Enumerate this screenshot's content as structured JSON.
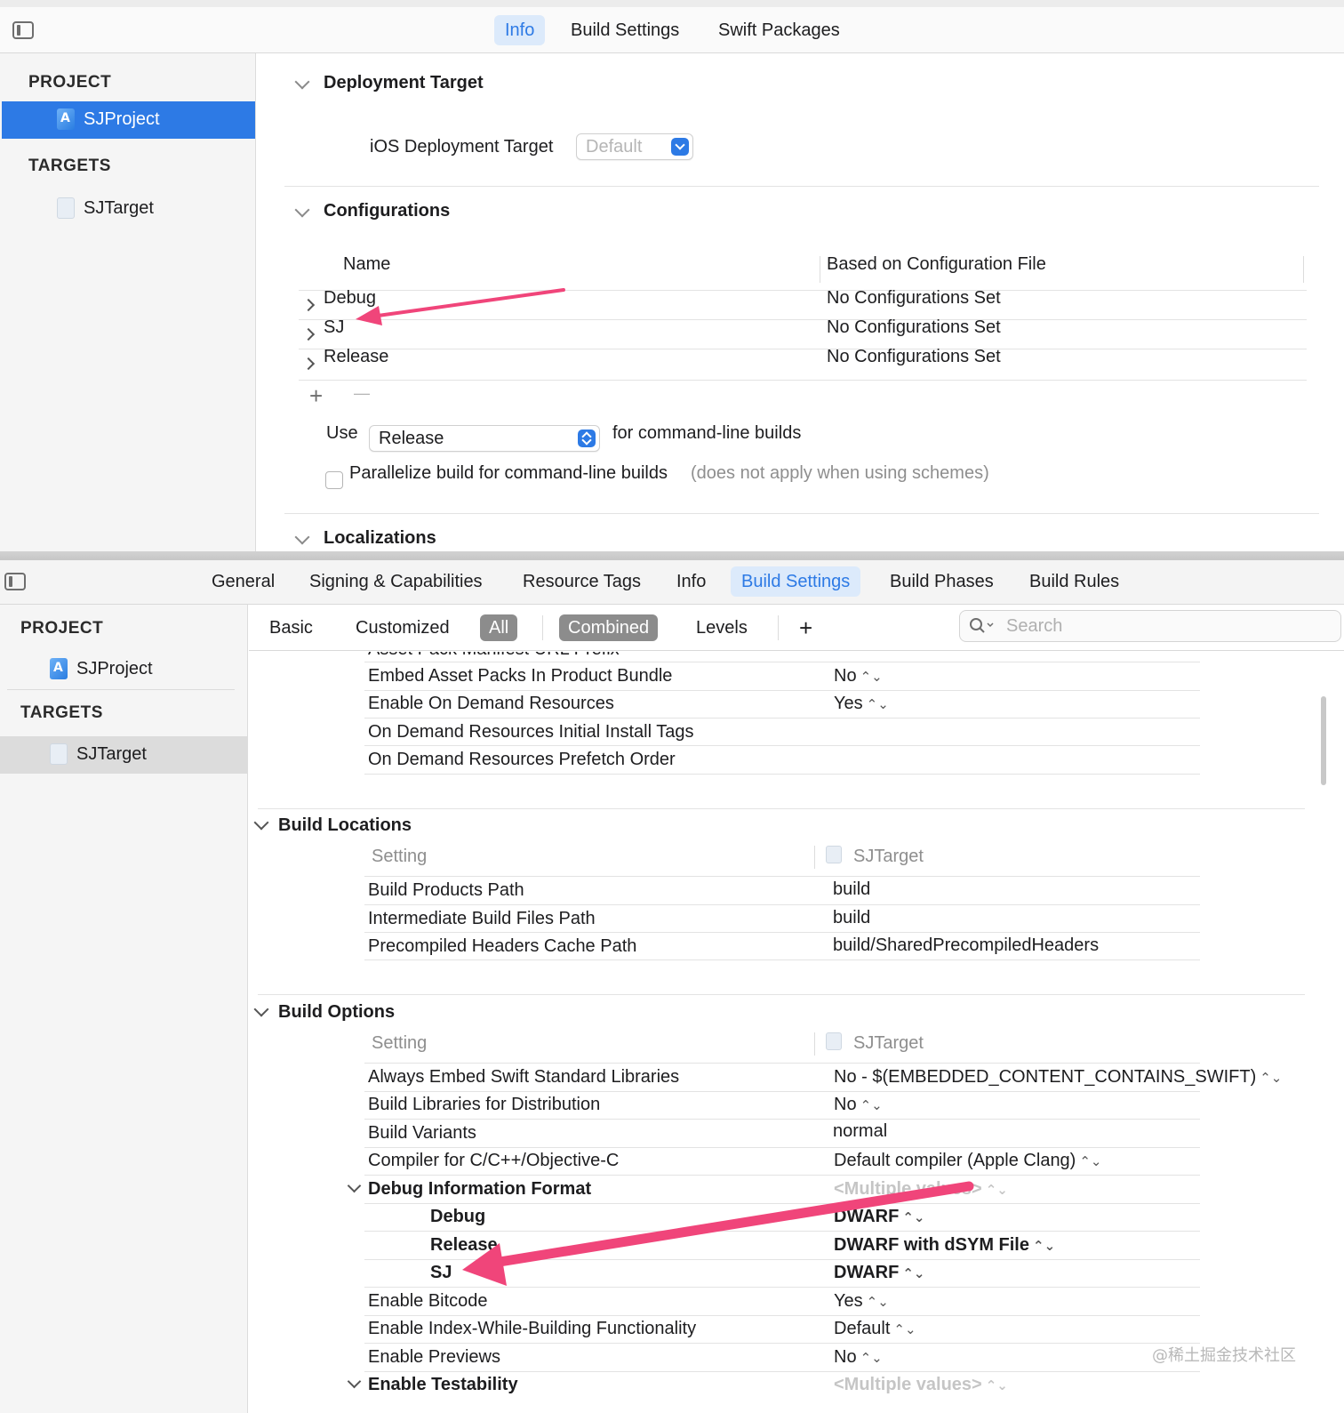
{
  "top": {
    "tabs": [
      "Info",
      "Build Settings",
      "Swift Packages"
    ],
    "active_tab": "Info",
    "sidebar": {
      "project_heading": "PROJECT",
      "project_item": "SJProject",
      "targets_heading": "TARGETS",
      "target_item": "SJTarget"
    },
    "deployment": {
      "title": "Deployment Target",
      "label": "iOS Deployment Target",
      "value": "Default"
    },
    "configurations": {
      "title": "Configurations",
      "col_name": "Name",
      "col_based": "Based on Configuration File",
      "rows": [
        {
          "name": "Debug",
          "based": "No Configurations Set"
        },
        {
          "name": "SJ",
          "based": "No Configurations Set"
        },
        {
          "name": "Release",
          "based": "No Configurations Set"
        }
      ],
      "add_symbol": "+",
      "remove_symbol": "—",
      "use_label": "Use",
      "use_value": "Release",
      "use_suffix": "for command-line builds",
      "parallelize_label": "Parallelize build for command-line builds",
      "parallelize_note": "(does not apply when using schemes)"
    },
    "localizations": {
      "title": "Localizations"
    }
  },
  "bottom": {
    "tabs": [
      "General",
      "Signing & Capabilities",
      "Resource Tags",
      "Info",
      "Build Settings",
      "Build Phases",
      "Build Rules"
    ],
    "active_tab": "Build Settings",
    "sidebar": {
      "project_heading": "PROJECT",
      "project_item": "SJProject",
      "targets_heading": "TARGETS",
      "target_item": "SJTarget"
    },
    "filters": [
      "Basic",
      "Customized",
      "All",
      "Combined",
      "Levels"
    ],
    "add_symbol": "+",
    "search_placeholder": "Search",
    "truncated_row": "Asset Pack Manifest URL Prefix",
    "asset_rows": [
      {
        "name": "Embed Asset Packs In Product Bundle",
        "value": "No",
        "stepper": true
      },
      {
        "name": "Enable On Demand Resources",
        "value": "Yes",
        "stepper": true
      },
      {
        "name": "On Demand Resources Initial Install Tags",
        "value": "",
        "stepper": false
      },
      {
        "name": "On Demand Resources Prefetch Order",
        "value": "",
        "stepper": false
      }
    ],
    "build_locations": {
      "title": "Build Locations",
      "col_setting": "Setting",
      "col_target": "SJTarget",
      "rows": [
        {
          "name": "Build Products Path",
          "value": "build"
        },
        {
          "name": "Intermediate Build Files Path",
          "value": "build"
        },
        {
          "name": "Precompiled Headers Cache Path",
          "value": "build/SharedPrecompiledHeaders"
        }
      ]
    },
    "build_options": {
      "title": "Build Options",
      "col_setting": "Setting",
      "col_target": "SJTarget",
      "rows": [
        {
          "name": "Always Embed Swift Standard Libraries",
          "value": "No  -  $(EMBEDDED_CONTENT_CONTAINS_SWIFT)",
          "stepper": true
        },
        {
          "name": "Build Libraries for Distribution",
          "value": "No",
          "stepper": true
        },
        {
          "name": "Build Variants",
          "value": "normal",
          "stepper": false
        },
        {
          "name": "Compiler for C/C++/Objective-C",
          "value": "Default compiler (Apple Clang)",
          "stepper": true
        }
      ],
      "debug_info": {
        "name": "Debug Information Format",
        "value": "<Multiple values>",
        "children": [
          {
            "name": "Debug",
            "value": "DWARF"
          },
          {
            "name": "Release",
            "value": "DWARF with dSYM File"
          },
          {
            "name": "SJ",
            "value": "DWARF"
          }
        ]
      },
      "rows_after": [
        {
          "name": "Enable Bitcode",
          "value": "Yes"
        },
        {
          "name": "Enable Index-While-Building Functionality",
          "value": "Default"
        },
        {
          "name": "Enable Previews",
          "value": "No"
        }
      ],
      "testability": {
        "name": "Enable Testability",
        "value": "<Multiple values>"
      }
    }
  },
  "stepper_glyph": "⌃⌄",
  "watermark": "@稀土掘金技术社区",
  "colors": {
    "accent": "#2d7ae5",
    "arrow": "#f0457a",
    "selection": "#2d7ae5"
  }
}
